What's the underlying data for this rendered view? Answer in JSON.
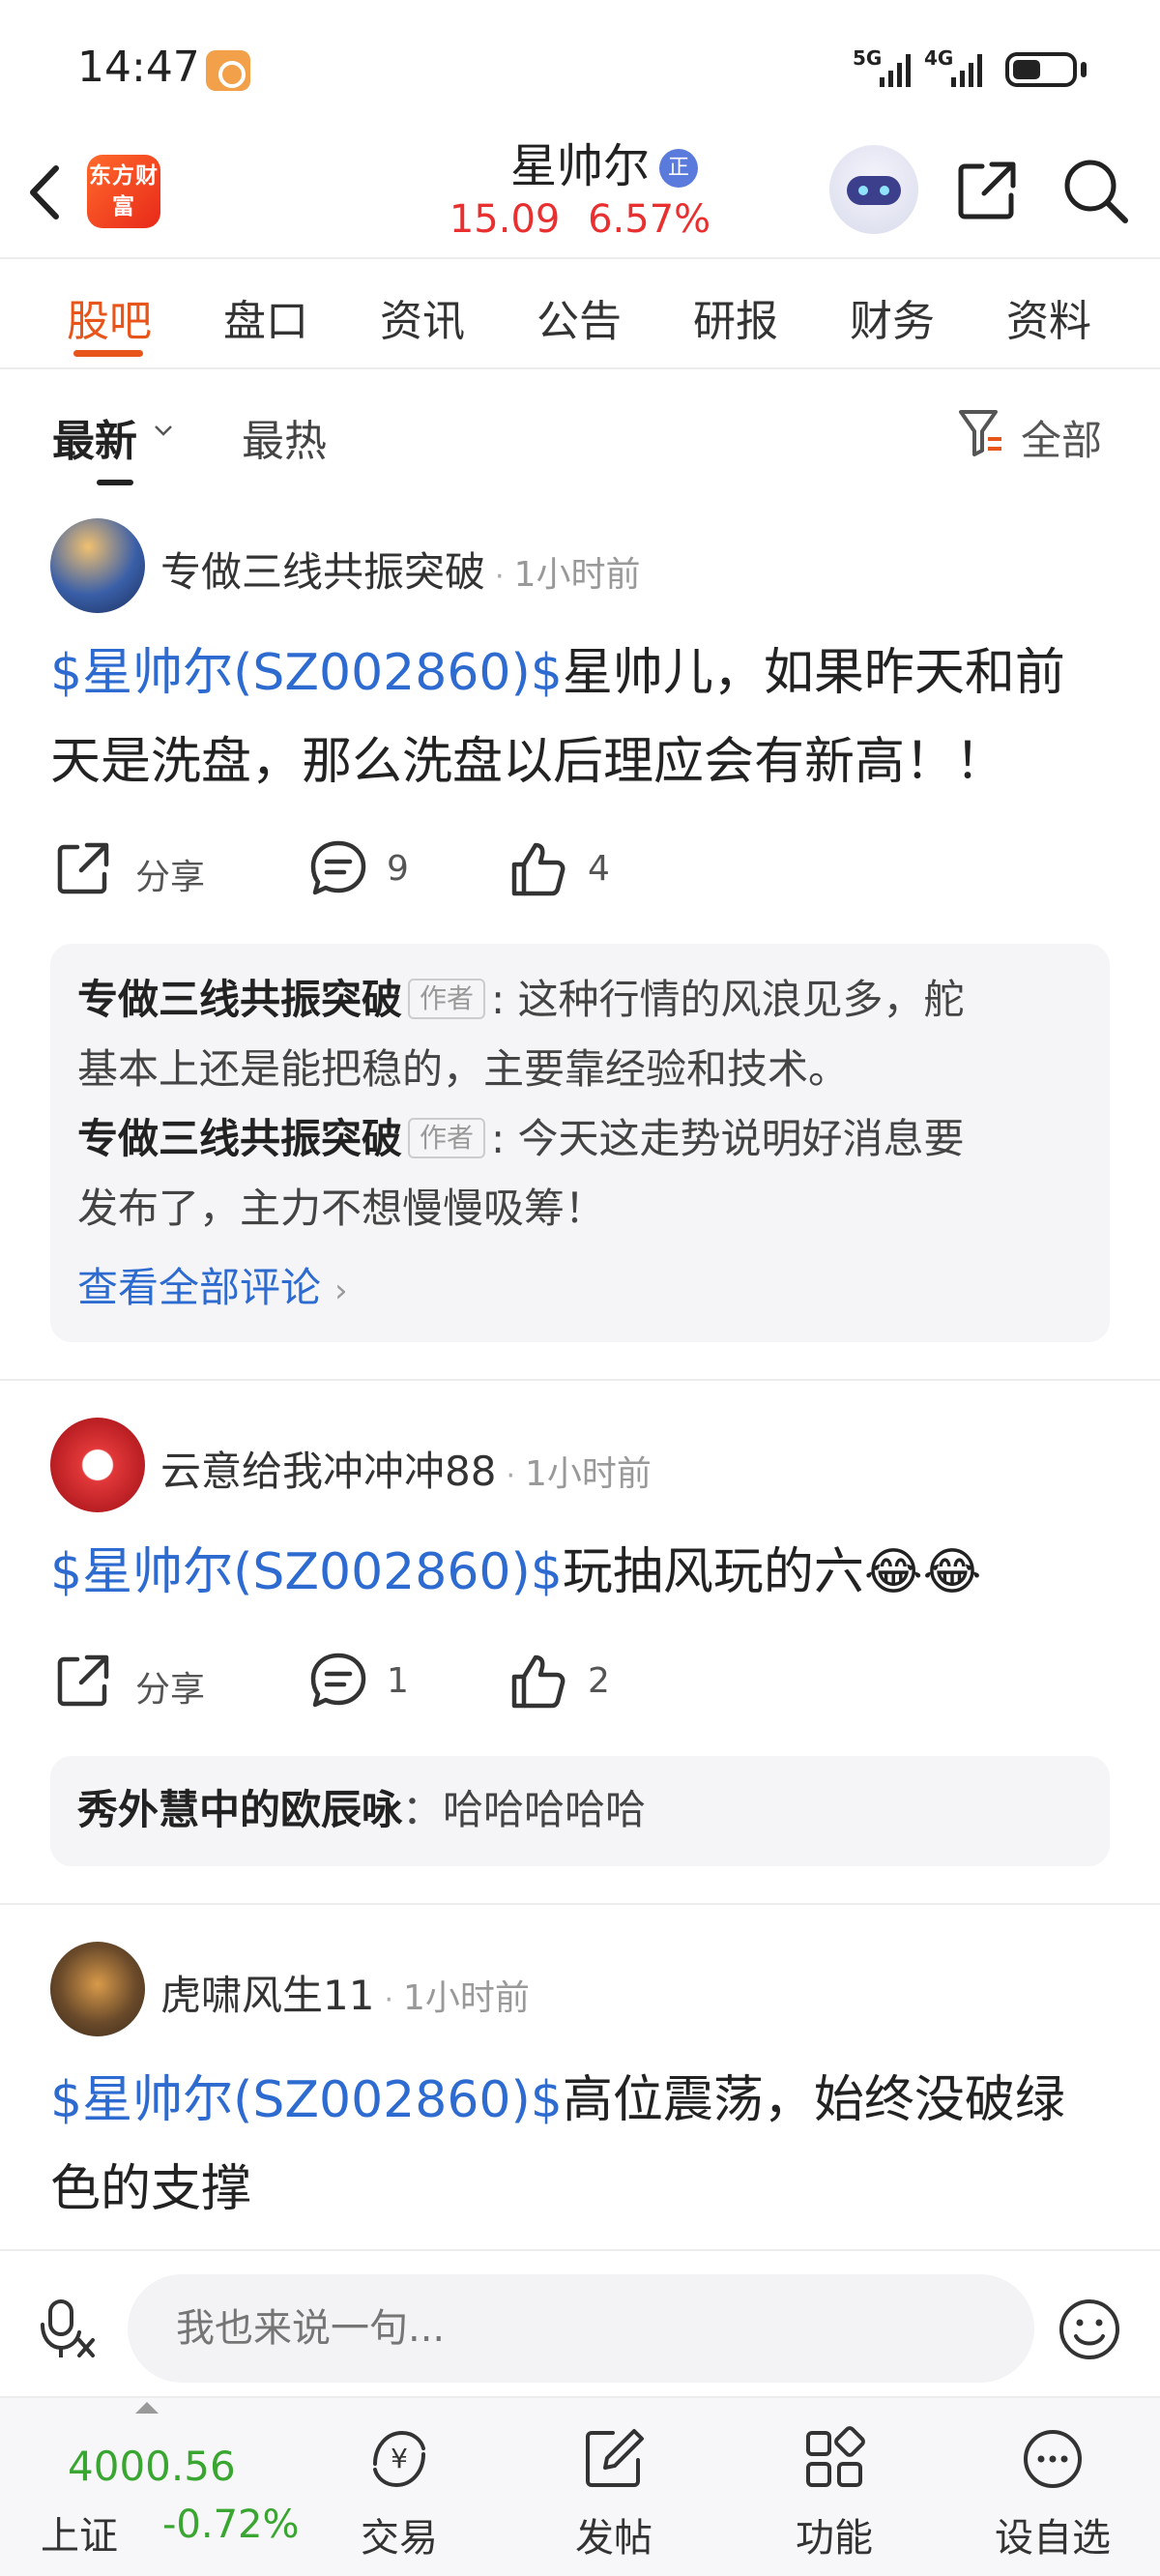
{
  "status_bar": {
    "time": "14:47",
    "signal_1": "5G",
    "signal_2": "4G"
  },
  "header": {
    "logo_text": "东方财富",
    "stock_name": "星帅尔",
    "badge": "正",
    "price": "15.09",
    "change_pct": "6.57%"
  },
  "tabs": [
    "股吧",
    "盘口",
    "资讯",
    "公告",
    "研报",
    "财务",
    "资料"
  ],
  "sort_bar": {
    "latest": "最新",
    "hot": "最热",
    "filter": "全部"
  },
  "posts": [
    {
      "author": "专做三线共振突破",
      "time": "1小时前",
      "tag": "$星帅尔(SZ002860)$",
      "text_line1": "星帅儿，如果昨天和前",
      "text_line2": "天是洗盘，那么洗盘以后理应会有新高！！",
      "share": "分享",
      "comments": "9",
      "likes": "4",
      "replies": [
        {
          "name": "专做三线共振突破",
          "badge": "作者",
          "line1": ": 这种行情的风浪见多，舵",
          "line2": "基本上还是能把稳的，主要靠经验和技术。"
        },
        {
          "name": "专做三线共振突破",
          "badge": "作者",
          "line1": ": 今天这走势说明好消息要",
          "line2": "发布了，主力不想慢慢吸筹！"
        }
      ],
      "view_all": "查看全部评论"
    },
    {
      "author": "云意给我冲冲冲88",
      "time": "1小时前",
      "tag": "$星帅尔(SZ002860)$",
      "text_line1": "玩抽风玩的六😂😂",
      "share": "分享",
      "comments": "1",
      "likes": "2",
      "reply": {
        "name": "秀外慧中的欧辰咏",
        "text": "：哈哈哈哈哈"
      }
    },
    {
      "author": "虎啸风生11",
      "time": "1小时前",
      "tag": "$星帅尔(SZ002860)$",
      "text_line1": "高位震荡，始终没破绿",
      "text_line2": "色的支撑"
    }
  ],
  "input": {
    "placeholder": "我也来说一句..."
  },
  "bottom_nav": {
    "index_value": "4000.56",
    "index_name": "上证",
    "index_change": "-0.72%",
    "items": [
      "交易",
      "发帖",
      "功能",
      "设自选"
    ]
  },
  "colors": {
    "accent": "#e8551a",
    "up": "#e93030",
    "down": "#3aa632",
    "link": "#2d6bd0"
  }
}
